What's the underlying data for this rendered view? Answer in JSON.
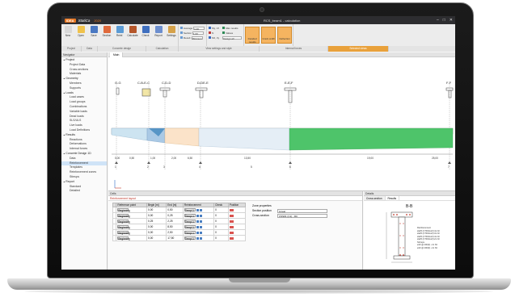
{
  "app": {
    "logo": "IDEA",
    "name": "StatiCa",
    "version": "2020",
    "file": "RCS_beam1 - calculation",
    "window_controls": [
      "–",
      "□",
      "✕"
    ]
  },
  "ribbon": {
    "buttons": [
      {
        "label": "New",
        "icon": "new-file-icon",
        "color": "#d8d8d8"
      },
      {
        "label": "Open",
        "icon": "open-folder-icon",
        "color": "#f0c24b"
      },
      {
        "label": "Save",
        "icon": "save-icon",
        "color": "#4a78c2"
      },
      {
        "label": "Section",
        "icon": "section-icon",
        "color": "#e06a3c"
      },
      {
        "label": "Reinf.",
        "icon": "reinforcement-icon",
        "color": "#5b9bd5"
      },
      {
        "label": "Calculate",
        "icon": "calculate-icon",
        "color": "#b5562a"
      },
      {
        "label": "Check",
        "icon": "check-icon",
        "color": "#3f6fbf"
      },
      {
        "label": "Report",
        "icon": "report-icon",
        "color": "#6d8fcf"
      },
      {
        "label": "Settings",
        "icon": "settings-icon",
        "color": "#d6a24a"
      }
    ],
    "view_options": [
      "Average",
      "Section",
      "Result"
    ],
    "view_values": [
      "1.00",
      "1.00",
      "Minimum"
    ],
    "force_options": [
      "My, Vz",
      "N",
      "Mz, Vy",
      "Tx"
    ],
    "result_options": [
      "Max results",
      "Values"
    ],
    "result_select": "Design all",
    "special": [
      "Detailed results",
      "Crack width",
      "Deflection"
    ],
    "groups": [
      {
        "label": "Project",
        "w": 20
      },
      {
        "label": "Data",
        "w": 16
      },
      {
        "label": "Concrete design",
        "w": 48
      },
      {
        "label": "Calculation",
        "w": 32
      },
      {
        "label": "View settings and style",
        "w": 80
      },
      {
        "label": "Internal forces",
        "w": 68
      },
      {
        "label": "Selected views",
        "w": 60
      }
    ]
  },
  "navigator": {
    "title": "Navigator",
    "items": [
      {
        "label": "Project",
        "level": 0
      },
      {
        "label": "Project Data",
        "level": 1
      },
      {
        "label": "Cross-sections",
        "level": 1
      },
      {
        "label": "Materials",
        "level": 1
      },
      {
        "label": "Geometry",
        "level": 0
      },
      {
        "label": "Members",
        "level": 1
      },
      {
        "label": "Supports",
        "level": 1
      },
      {
        "label": "Loads",
        "level": 0
      },
      {
        "label": "Load cases",
        "level": 1
      },
      {
        "label": "Load groups",
        "level": 1
      },
      {
        "label": "Combinations",
        "level": 1
      },
      {
        "label": "Variable loads",
        "level": 1
      },
      {
        "label": "Dead loads",
        "level": 1
      },
      {
        "label": "SLS/ULS",
        "level": 1
      },
      {
        "label": "Live loads",
        "level": 1
      },
      {
        "label": "Load Definitions",
        "level": 1
      },
      {
        "label": "Results",
        "level": 0
      },
      {
        "label": "Reactions",
        "level": 1
      },
      {
        "label": "Deformations",
        "level": 1
      },
      {
        "label": "Internal forces",
        "level": 1
      },
      {
        "label": "Concrete Design 1D",
        "level": 0
      },
      {
        "label": "Data",
        "level": 1
      },
      {
        "label": "Reinforcement",
        "level": 1,
        "selected": true
      },
      {
        "label": "Templates",
        "level": 1
      },
      {
        "label": "Reinforcement zones",
        "level": 1
      },
      {
        "label": "Stirrups",
        "level": 1
      },
      {
        "label": "Report",
        "level": 0
      },
      {
        "label": "Standard",
        "level": 1
      },
      {
        "label": "Detailed",
        "level": 1
      }
    ]
  },
  "main": {
    "tab": "Main",
    "sections": [
      "G-G",
      "C-B-E-C",
      "C-D-D",
      "D-DE-E",
      "E-E-F",
      "F-F"
    ],
    "dims": [
      "0,00",
      "0,50",
      "1,00",
      "2,00",
      "6,50",
      "13,50",
      "19,00",
      "25,00"
    ],
    "supports": [
      "1",
      "2",
      "3",
      "4",
      "5",
      "6",
      "7"
    ]
  },
  "cells": {
    "title": "Cells",
    "subtitle": "Reinforcement layout",
    "columns": [
      "Reference point",
      "Begin [m]",
      "End [m]",
      "Reinforcement",
      "Check",
      "Position"
    ],
    "rows": [
      {
        "ref": "Beginning",
        "begin": "0,00",
        "end": "0,50",
        "reinf": "Templ.1",
        "check": "0"
      },
      {
        "ref": "Beginning",
        "begin": "0,00",
        "end": "0,25",
        "reinf": "Templ.1",
        "check": "0"
      },
      {
        "ref": "Beginning",
        "begin": "0,25",
        "end": "2,25",
        "reinf": "Templ.1",
        "check": "0"
      },
      {
        "ref": "Beginning",
        "begin": "0,00",
        "end": "8,50",
        "reinf": "Templ.1",
        "check": "0"
      },
      {
        "ref": "Beginning",
        "begin": "0,00",
        "end": "2,50",
        "reinf": "Templ.1",
        "check": "0"
      },
      {
        "ref": "Beginning",
        "begin": "0,00",
        "end": "17,50",
        "reinf": "Templ.1",
        "check": "0"
      }
    ],
    "props": {
      "title": "Zone properties",
      "rows": [
        {
          "k": "Section position",
          "v": "Linear"
        },
        {
          "k": "Cross-section",
          "v": "CSS#1 (C1) - RC"
        }
      ]
    }
  },
  "details": {
    "title": "Details",
    "tabs": [
      "Cross-section",
      "Results"
    ],
    "section": "B-B",
    "reinf_text": [
      "Reinforcement",
      "2ø25 (CTR.Reinf) 4x Nz",
      "2ø25 (CTR.Reinf) 3x Nz",
      "2ø25 (CTR.Reinf) 4x Nz",
      "2ø25 (CTR.Reinf) 2x Nz",
      "Stirrups",
      "ø10 @ 200(0) • 2x Nz",
      "ø10 @ 200(0) • 2x Nz"
    ]
  }
}
